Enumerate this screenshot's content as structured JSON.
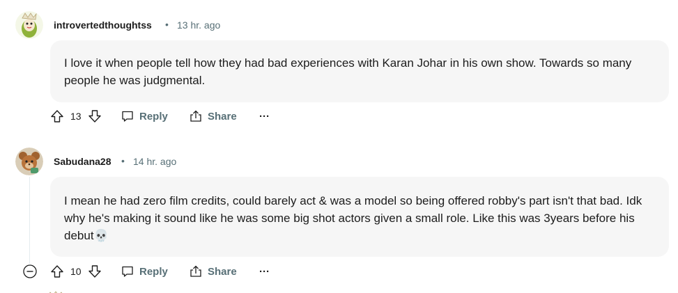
{
  "comments": [
    {
      "username": "introvertedthoughtss",
      "separator": "•",
      "time": "13 hr. ago",
      "text": "I love it when people tell how they had bad experiences with Karan Johar in his own show. Towards so many people he was judgmental.",
      "votes": "13",
      "reply_label": "Reply",
      "share_label": "Share",
      "more_label": "···"
    },
    {
      "username": "Sabudana28",
      "separator": "•",
      "time": "14 hr. ago",
      "text": "I mean he had zero film credits, could barely act & was a model so being offered robby's part isn't that bad. Idk why he's making it sound like he was some big shot actors given a small role. Like this was 3years before his debut💀",
      "votes": "10",
      "reply_label": "Reply",
      "share_label": "Share",
      "more_label": "···"
    }
  ],
  "icons": {
    "upvote": "upvote-icon",
    "downvote": "downvote-icon",
    "reply": "reply-icon",
    "share": "share-icon",
    "collapse": "collapse-icon"
  }
}
